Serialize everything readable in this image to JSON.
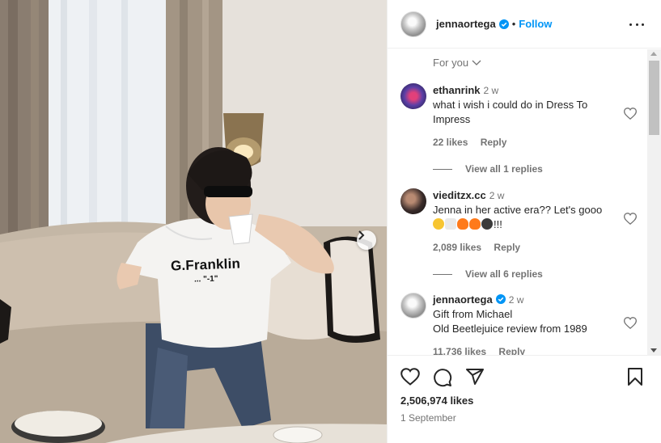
{
  "post": {
    "username": "jennaortega",
    "follow_label": "Follow",
    "dot": "•",
    "shirt_line1": "G.Franklin",
    "shirt_line2": "... \"-1\"",
    "likes": "2,506,974 likes",
    "date": "1 September"
  },
  "comments_section": {
    "sort_label": "For you",
    "comments": [
      {
        "user": "ethanrink",
        "time": "2 w",
        "text": "what i wish i could do in Dress To Impress",
        "likes": "22 likes",
        "reply": "Reply",
        "view_replies": "View all 1 replies"
      },
      {
        "user": "vieditzx.cc",
        "time": "2 w",
        "text": "Jenna in her active era?? Let's gooo",
        "text2": "!!!",
        "likes": "2,089 likes",
        "reply": "Reply",
        "view_replies": "View all 6 replies"
      },
      {
        "user": "jennaortega",
        "time": "2 w",
        "text": "Gift from Michael",
        "text2": "Old Beetlejuice review from 1989",
        "likes": "11,736 likes",
        "reply": "Reply"
      }
    ]
  },
  "icons": [
    "verified-badge-icon",
    "more-options-icon",
    "chevron-down-icon",
    "heart-icon",
    "comment-icon",
    "share-icon",
    "bookmark-icon",
    "chevron-right-icon"
  ],
  "colors": {
    "accent": "#0095f6",
    "text": "#262626",
    "muted": "#737373"
  }
}
